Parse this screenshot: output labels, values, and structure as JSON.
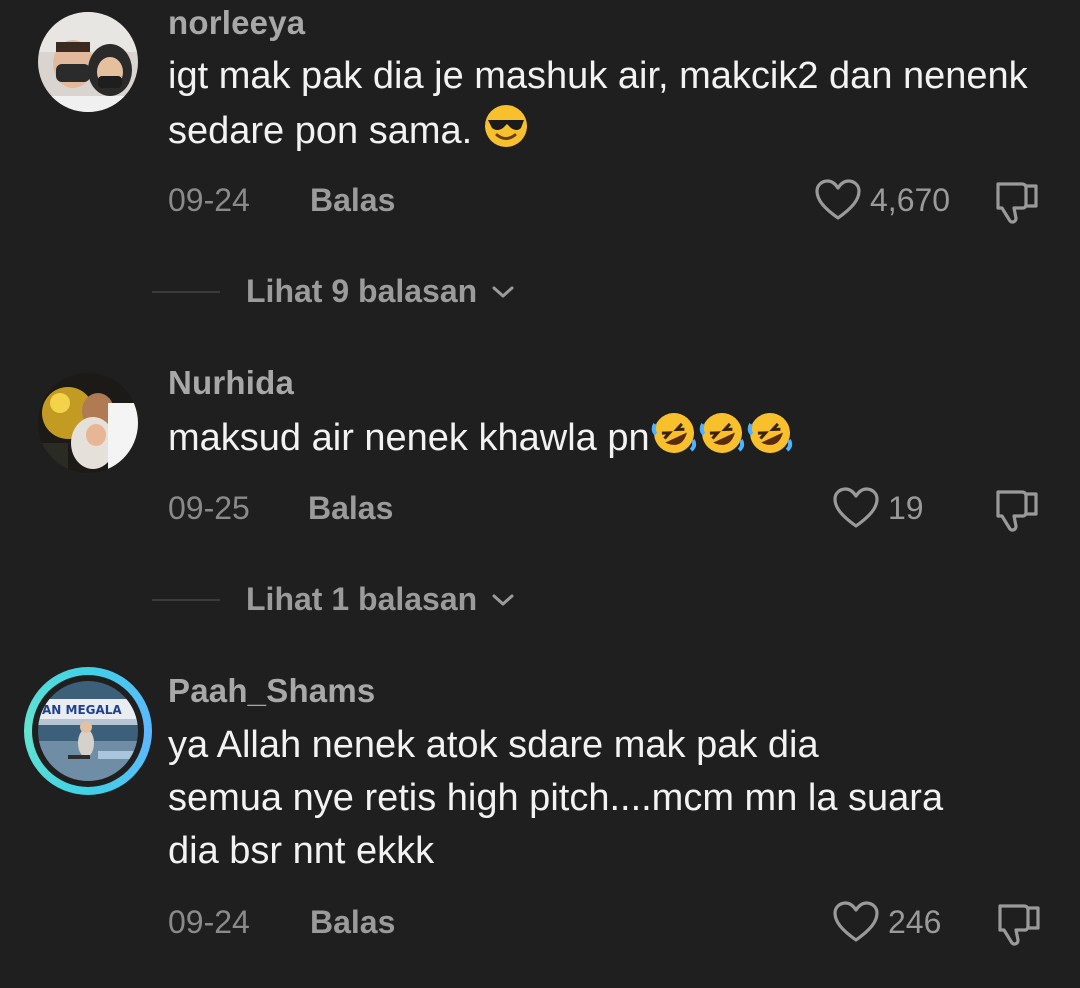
{
  "comments": [
    {
      "username": "norleeya",
      "text": "igt mak pak dia je mashuk air, makcik2 dan nenenk sedare pon sama.",
      "emoji": "sunglasses-emoji",
      "date": "09-24",
      "reply_label": "Balas",
      "likes": "4,670",
      "view_replies": "Lihat 9 balasan"
    },
    {
      "username": "Nurhida",
      "text": "maksud air nenek khawla pn",
      "emoji": "rofl-emoji x3",
      "date": "09-25",
      "reply_label": "Balas",
      "likes": "19",
      "view_replies": "Lihat 1 balasan"
    },
    {
      "username": "Paah_Shams",
      "text_lines": [
        "ya Allah nenek atok sdare mak pak dia",
        "semua nye retis high pitch....mcm mn la suara",
        "dia bsr nnt ekkk"
      ],
      "avatar_caption": "AN MEGALA",
      "date": "09-24",
      "reply_label": "Balas",
      "likes": "246"
    }
  ],
  "colors": {
    "background": "#1f1f1f",
    "username": "#a8a8a8",
    "muted": "#8a8a8a",
    "story_ring": "#3fd1e6"
  }
}
